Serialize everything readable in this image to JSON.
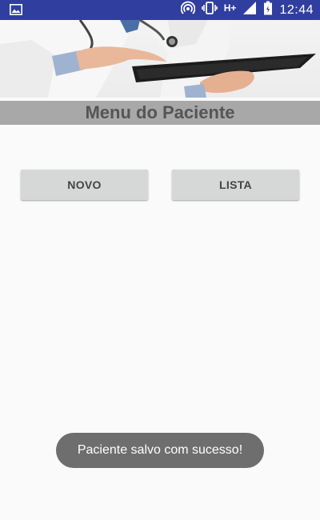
{
  "status_bar": {
    "network_label": "H+",
    "time": "12:44",
    "icons": [
      "gallery-icon",
      "hotspot-icon",
      "vibrate-icon",
      "signal-icon",
      "battery-icon"
    ]
  },
  "header": {
    "image": "doctor-with-tablet-photo"
  },
  "title_bar": {
    "title": "Menu do Paciente"
  },
  "buttons": {
    "novo_label": "NOVO",
    "lista_label": "LISTA"
  },
  "toast": {
    "message": "Paciente salvo com sucesso!"
  },
  "colors": {
    "status_bar": "#303f9f",
    "title_bar": "#a8a8a8",
    "button": "#d6d7d7",
    "toast": "#6e6e6e"
  }
}
